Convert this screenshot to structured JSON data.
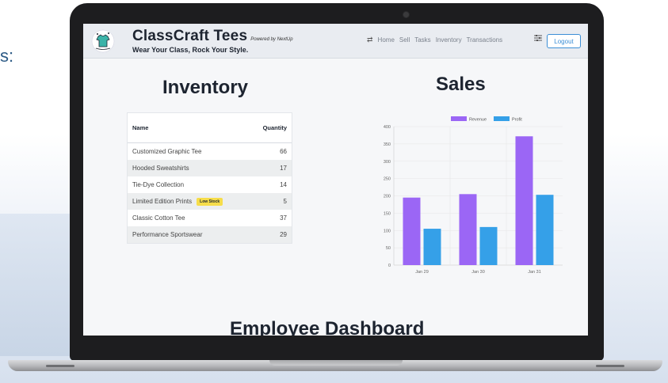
{
  "background": {
    "left_text": "s:"
  },
  "app": {
    "brand_title": "ClassCraft Tees",
    "powered_by": "Powered by NextUp",
    "tagline": "Wear Your Class, Rock Your Style.",
    "nav": [
      "Home",
      "Sell",
      "Tasks",
      "Inventory",
      "Transactions"
    ],
    "logout_label": "Logout",
    "accent_color": "#3b8ed6"
  },
  "inventory": {
    "title": "Inventory",
    "headers": {
      "name": "Name",
      "quantity": "Quantity"
    },
    "rows": [
      {
        "name": "Customized Graphic Tee",
        "quantity": "66",
        "badge": ""
      },
      {
        "name": "Hooded Sweatshirts",
        "quantity": "17",
        "badge": ""
      },
      {
        "name": "Tie-Dye Collection",
        "quantity": "14",
        "badge": ""
      },
      {
        "name": "Limited Edition Prints",
        "quantity": "5",
        "badge": "Low Stock"
      },
      {
        "name": "Classic Cotton Tee",
        "quantity": "37",
        "badge": ""
      },
      {
        "name": "Performance Sportswear",
        "quantity": "29",
        "badge": ""
      }
    ]
  },
  "sales": {
    "title": "Sales"
  },
  "employee": {
    "title": "Employee Dashboard"
  },
  "chart_data": {
    "type": "bar",
    "categories": [
      "Jan 29",
      "Jan 30",
      "Jan 31"
    ],
    "series": [
      {
        "name": "Revenue",
        "values": [
          195,
          205,
          372
        ],
        "color": "#9b66f5"
      },
      {
        "name": "Profit",
        "values": [
          105,
          110,
          203
        ],
        "color": "#35a0e8"
      }
    ],
    "ylim": [
      0,
      400
    ],
    "yticks": [
      0,
      50,
      100,
      150,
      200,
      250,
      300,
      350,
      400
    ],
    "legend": "top",
    "grid": true
  }
}
